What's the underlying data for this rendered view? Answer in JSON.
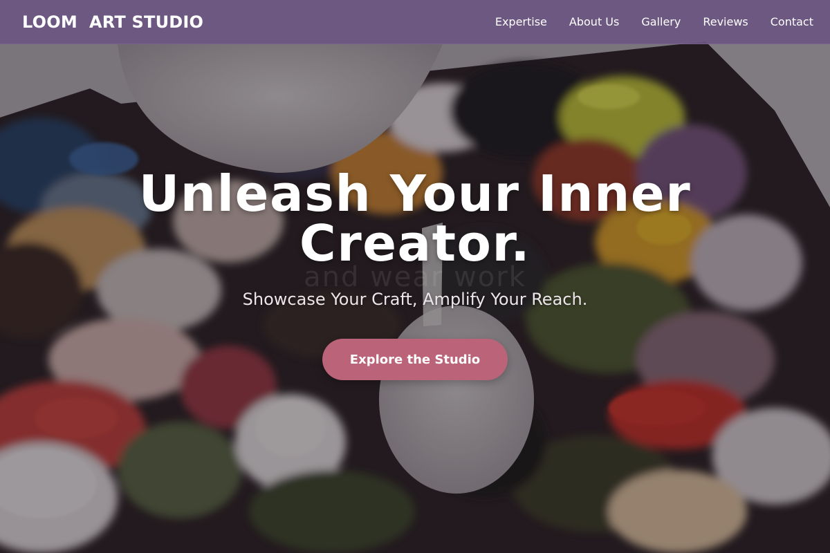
{
  "header": {
    "brand": "LOOM  ART STUDIO",
    "nav": [
      {
        "label": "Expertise"
      },
      {
        "label": "About Us"
      },
      {
        "label": "Gallery"
      },
      {
        "label": "Reviews"
      },
      {
        "label": "Contact"
      }
    ]
  },
  "hero": {
    "title": "Unleash Your Inner Creator.",
    "watermark": "and wear work",
    "subtitle": "Showcase Your Craft, Amplify Your Reach.",
    "cta_label": "Explore the Studio"
  },
  "colors": {
    "header_bg": "#6c5682",
    "cta_bg": "#bb6479",
    "text": "#ffffff"
  }
}
